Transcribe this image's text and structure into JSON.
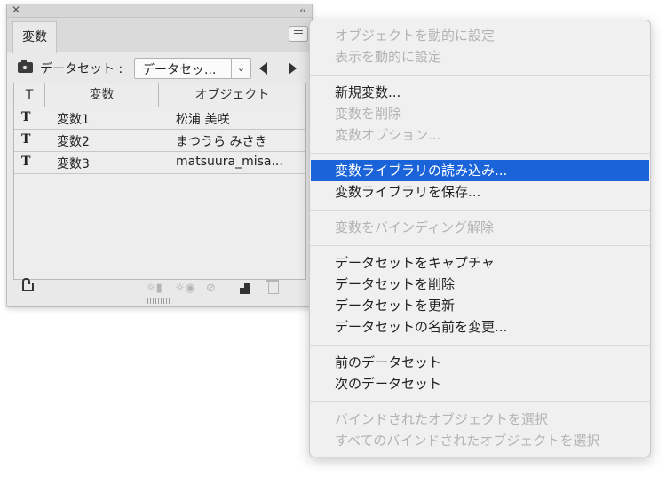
{
  "panel": {
    "close_glyph": "✕",
    "collapse_glyph": "‹‹",
    "tab_label": "変数",
    "dataset_label": "データセット :",
    "dataset_value": "データセッ...",
    "dropdown_glyph": "⌄",
    "columns": [
      "T",
      "変数",
      "オブジェクト"
    ],
    "rows": [
      {
        "type_icon": "T",
        "name": "変数1",
        "object": "松浦 美咲"
      },
      {
        "type_icon": "T",
        "name": "変数2",
        "object": "まつうら みさき"
      },
      {
        "type_icon": "T",
        "name": "変数3",
        "object": "matsuura_misa..."
      }
    ]
  },
  "menu": {
    "groups": [
      [
        {
          "label": "オブジェクトを動的に設定",
          "enabled": false
        },
        {
          "label": "表示を動的に設定",
          "enabled": false
        }
      ],
      [
        {
          "label": "新規変数...",
          "enabled": true
        },
        {
          "label": "変数を削除",
          "enabled": false
        },
        {
          "label": "変数オプション...",
          "enabled": false
        }
      ],
      [
        {
          "label": "変数ライブラリの読み込み...",
          "enabled": true,
          "highlighted": true
        },
        {
          "label": "変数ライブラリを保存...",
          "enabled": true
        }
      ],
      [
        {
          "label": "変数をバインディング解除",
          "enabled": false
        }
      ],
      [
        {
          "label": "データセットをキャプチャ",
          "enabled": true
        },
        {
          "label": "データセットを削除",
          "enabled": true
        },
        {
          "label": "データセットを更新",
          "enabled": true
        },
        {
          "label": "データセットの名前を変更...",
          "enabled": true
        }
      ],
      [
        {
          "label": "前のデータセット",
          "enabled": true
        },
        {
          "label": "次のデータセット",
          "enabled": true
        }
      ],
      [
        {
          "label": "バインドされたオブジェクトを選択",
          "enabled": false
        },
        {
          "label": "すべてのバインドされたオブジェクトを選択",
          "enabled": false
        }
      ]
    ]
  },
  "colors": {
    "highlight": "#1a63d8",
    "disabled_text": "#b3b3b3",
    "panel_bg": "#e9e9e9",
    "menu_bg": "#f0f0f0"
  }
}
